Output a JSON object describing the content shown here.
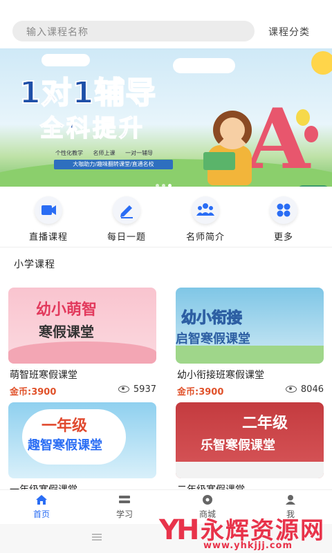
{
  "search": {
    "placeholder": "输入课程名称",
    "category_label": "课程分类"
  },
  "banner": {
    "headline_1": "1对1辅导",
    "headline_2": "全科提升",
    "tags": [
      "个性化教学",
      "名师上课",
      "一对一辅导"
    ],
    "ribbon": "大咖助力/趣味翻转课堂/直通名校",
    "active_slide": 3,
    "slide_count": 3
  },
  "quick_nav": [
    {
      "label": "直播课程",
      "icon": "video-camera-icon"
    },
    {
      "label": "每日一题",
      "icon": "pen-edit-icon"
    },
    {
      "label": "名师简介",
      "icon": "teachers-group-icon"
    },
    {
      "label": "更多",
      "icon": "more-grid-icon"
    }
  ],
  "section": {
    "title": "小学课程"
  },
  "courses": [
    {
      "thumb_line1": "幼小萌智",
      "thumb_line2": "寒假课堂",
      "title": "萌智班寒假课堂",
      "price": "金币:3900",
      "views": "5937"
    },
    {
      "thumb_line1": "幼小衔接",
      "thumb_line2": "启智寒假课堂",
      "title": "幼小衔接班寒假课堂",
      "price": "金币:3900",
      "views": "8046"
    },
    {
      "thumb_line1": "一年级",
      "thumb_line2": "趣智寒假课堂",
      "title": "一年级寒假课堂",
      "price": "",
      "views": ""
    },
    {
      "thumb_line1": "二年级",
      "thumb_line2": "乐智寒假课堂",
      "title": "二年级寒假课堂",
      "price": "",
      "views": ""
    }
  ],
  "tabs": [
    {
      "label": "首页",
      "icon": "home-icon",
      "active": true
    },
    {
      "label": "学习",
      "icon": "study-icon",
      "active": false
    },
    {
      "label": "商城",
      "icon": "shop-icon",
      "active": false
    },
    {
      "label": "我",
      "icon": "user-icon",
      "active": false
    }
  ],
  "watermark": {
    "logo": "YH",
    "name": "永辉资源网",
    "url": "www.yhkjjj.com"
  },
  "colors": {
    "accent": "#2a6df4",
    "price": "#e0522b",
    "watermark": "#e8334a"
  }
}
